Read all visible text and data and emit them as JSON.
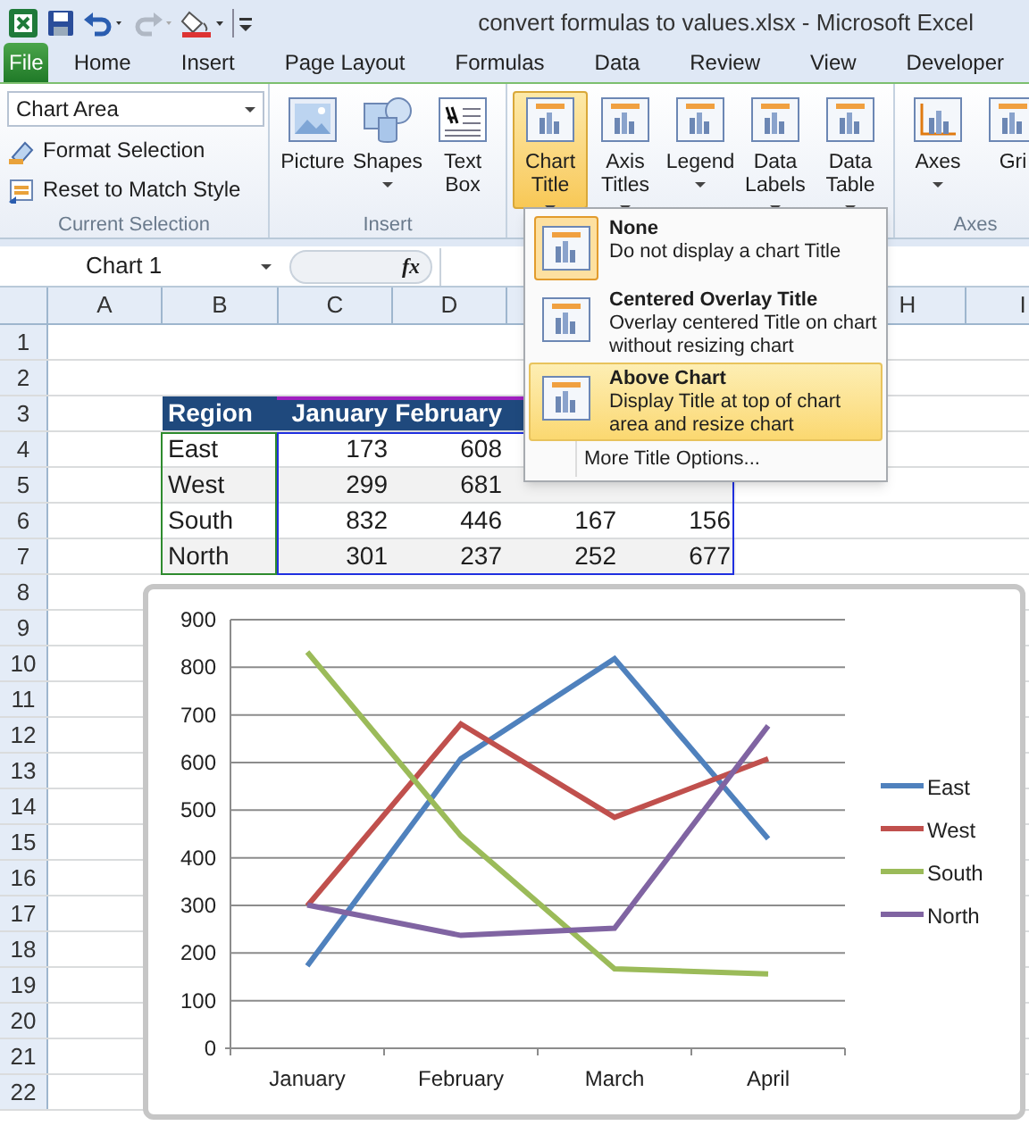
{
  "window": {
    "title": "convert formulas to values.xlsx  -  Microsoft Excel"
  },
  "ribbon_tabs": [
    {
      "label": "File",
      "kind": "file"
    },
    {
      "label": "Home",
      "kind": "tab"
    },
    {
      "label": "Insert",
      "kind": "tab"
    },
    {
      "label": "Page Layout",
      "kind": "tab"
    },
    {
      "label": "Formulas",
      "kind": "tab"
    },
    {
      "label": "Data",
      "kind": "tab"
    },
    {
      "label": "Review",
      "kind": "tab"
    },
    {
      "label": "View",
      "kind": "tab"
    },
    {
      "label": "Developer",
      "kind": "tab"
    }
  ],
  "ribbon": {
    "chart_element_box": {
      "value": "Chart Area"
    },
    "current_selection": [
      {
        "label": "Format Selection",
        "kind": "format"
      },
      {
        "label": "Reset to Match Style",
        "kind": "reset"
      }
    ],
    "groups": [
      {
        "label": "Current Selection",
        "kind": "selection"
      },
      {
        "label": "Insert",
        "kind": "buttons",
        "buttons": [
          {
            "label": "Picture",
            "kind": "picture",
            "dropdown": false,
            "pressed": false
          },
          {
            "label": "Shapes",
            "kind": "shapes",
            "dropdown": true,
            "pressed": false
          },
          {
            "label": "Text Box",
            "kind": "textbox",
            "dropdown": false,
            "pressed": false
          }
        ]
      },
      {
        "kind": "buttons",
        "buttons": [
          {
            "label": "Chart Title",
            "kind": "chart",
            "dropdown": true,
            "pressed": true
          },
          {
            "label": "Axis Titles",
            "kind": "chart",
            "dropdown": true,
            "pressed": false
          },
          {
            "label": "Legend",
            "kind": "chart",
            "dropdown": true,
            "pressed": false
          },
          {
            "label": "Data Labels",
            "kind": "chart",
            "dropdown": true,
            "pressed": false
          },
          {
            "label": "Data Table",
            "kind": "chart",
            "dropdown": true,
            "pressed": false
          }
        ]
      },
      {
        "label": "Axes",
        "kind": "buttons",
        "buttons": [
          {
            "label": "Axes",
            "kind": "axes",
            "dropdown": true,
            "pressed": false
          },
          {
            "label": "Gri",
            "kind": "chart",
            "dropdown": false,
            "pressed": false
          }
        ]
      }
    ]
  },
  "chart_title_menu": {
    "items": [
      {
        "title": "None",
        "description": "Do not display a chart Title",
        "current": true,
        "highlighted": false
      },
      {
        "title": "Centered Overlay Title",
        "description": "Overlay centered Title on chart without resizing chart",
        "current": false,
        "highlighted": false
      },
      {
        "title": "Above Chart",
        "description": "Display Title at top of chart area and resize chart",
        "current": false,
        "highlighted": true
      }
    ],
    "footer": "More Title Options..."
  },
  "formula_bar": {
    "name_box": "Chart 1",
    "fx": "fx"
  },
  "sheet": {
    "columns": [
      {
        "label": "A"
      },
      {
        "label": "B"
      },
      {
        "label": "C"
      },
      {
        "label": "D"
      },
      {},
      {},
      {},
      {
        "label": "H"
      },
      {
        "label": "I"
      }
    ],
    "row_numbers": [
      "1",
      "2",
      "3",
      "4",
      "5",
      "6",
      "7",
      "8",
      "9",
      "10",
      "11",
      "12",
      "13",
      "14",
      "15",
      "16",
      "17",
      "18",
      "19",
      "20",
      "21",
      "22"
    ],
    "table": {
      "header": [
        "Region",
        "January",
        "February"
      ],
      "rows": [
        {
          "cells": [
            "East",
            "173",
            "608"
          ]
        },
        {
          "cells": [
            "West",
            "299",
            "681"
          ]
        },
        {
          "cells": [
            "South",
            "832",
            "446",
            "167",
            "156"
          ]
        },
        {
          "cells": [
            "North",
            "301",
            "237",
            "252",
            "677"
          ]
        }
      ]
    }
  },
  "chart_data": {
    "type": "line",
    "grid": true,
    "legend": true,
    "categories": [
      "January",
      "February",
      "March",
      "April"
    ],
    "ylim": [
      0,
      900
    ],
    "yticks": [
      0,
      100,
      200,
      300,
      400,
      500,
      600,
      700,
      800,
      900
    ],
    "series": [
      {
        "name": "East",
        "color": "#4f81bd",
        "values": [
          173,
          608,
          818,
          440
        ]
      },
      {
        "name": "West",
        "color": "#c0504d",
        "values": [
          299,
          681,
          485,
          608
        ]
      },
      {
        "name": "South",
        "color": "#9bbb59",
        "values": [
          832,
          446,
          167,
          156
        ]
      },
      {
        "name": "North",
        "color": "#8064a2",
        "values": [
          301,
          237,
          252,
          677
        ]
      }
    ]
  }
}
